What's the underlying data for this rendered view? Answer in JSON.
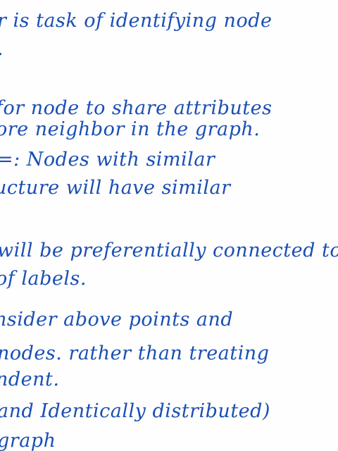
{
  "note": {
    "lines": [
      "r is task of identifying node",
      ".",
      "for node to share attributes",
      "ore neighbor in the graph.",
      "=: Nodes with similar",
      "ucture will have similar",
      "will be preferentially connected to",
      "of labels.",
      "nsider above points and",
      "nodes. rather than treating",
      "ndent.",
      "and Identically distributed)",
      "graph"
    ]
  },
  "colors": {
    "ink": "#1a4fb4",
    "paper": "#fefefe"
  }
}
